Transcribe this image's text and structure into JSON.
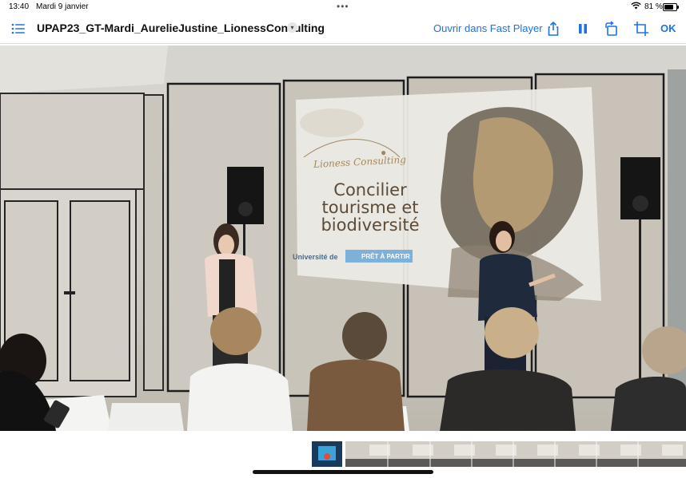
{
  "status_bar": {
    "time": "13:40",
    "date": "Mardi 9 janvier",
    "battery": "81 %"
  },
  "nav": {
    "title": "UPAP23_GT-Mardi_AurelieJustine_LionessConsulting",
    "open_in_label": "Ouvrir dans Fast Player",
    "ok_label": "OK"
  },
  "slide": {
    "logo_text": "Lioness Consulting",
    "headline_line1": "Concilier",
    "headline_line2": "tourisme et",
    "headline_line3": "biodiversité",
    "footer_university": "Université de",
    "footer_badge": "PRÊT À PARTIR"
  },
  "colors": {
    "accent": "#1a73e8"
  }
}
